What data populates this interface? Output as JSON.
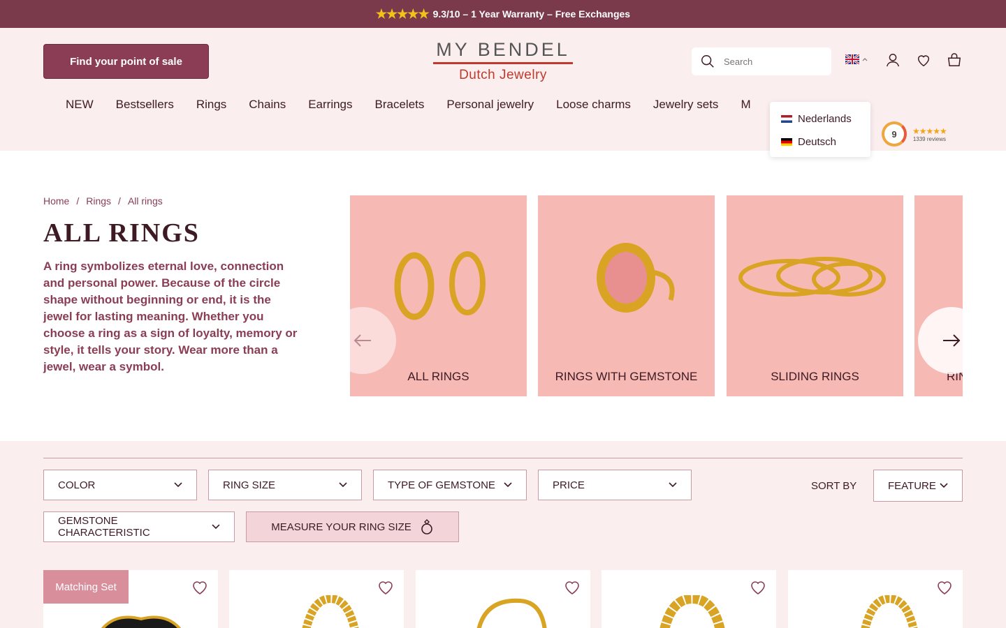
{
  "announcement": {
    "stars": "★★★★★",
    "text": "9.3/10 – 1 Year Warranty – Free Exchanges"
  },
  "header": {
    "pos_button": "Find your point of sale",
    "logo_top": "MY BENDEL",
    "logo_bottom": "Dutch Jewelry",
    "search_placeholder": "Search",
    "nav": [
      "NEW",
      "Bestsellers",
      "Rings",
      "Chains",
      "Earrings",
      "Bracelets",
      "Personal jewelry",
      "Loose charms",
      "Jewelry sets",
      "M"
    ],
    "languages": [
      "Nederlands",
      "Deutsch"
    ],
    "review_score": "9",
    "review_count": "1339 reviews",
    "review_stars": "★★★★★"
  },
  "hero": {
    "breadcrumb": [
      "Home",
      "Rings",
      "All rings"
    ],
    "title": "ALL RINGS",
    "description": "A ring symbolizes eternal love, connection and personal power. Because of the circle shape without beginning or end, it is the jewel for lasting meaning. Whether you choose a ring as a sign of loyalty, memory or style, it tells your story. Wear more than a jewel, wear a symbol.",
    "categories": [
      "ALL RINGS",
      "RINGS WITH GEMSTONE",
      "SLIDING RINGS",
      "RIN"
    ]
  },
  "filters": {
    "color": "COLOR",
    "ring_size": "RING SIZE",
    "gemstone_type": "TYPE OF GEMSTONE",
    "price": "PRICE",
    "sort_label": "SORT BY",
    "sort_value": "FEATURE",
    "gemstone_char": "GEMSTONE CHARACTERISTIC",
    "measure": "MEASURE YOUR RING SIZE"
  },
  "products": {
    "tag": "Matching Set"
  },
  "colors": {
    "brand": "#7a3a4c",
    "accent": "#8a3d54",
    "background": "#fbeeee"
  }
}
